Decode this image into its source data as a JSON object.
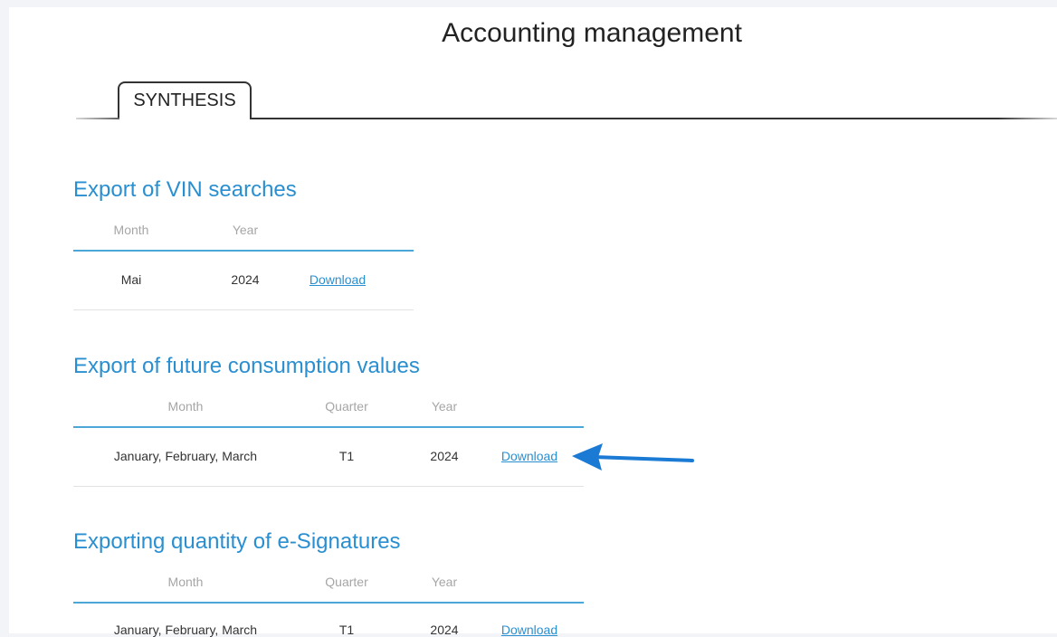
{
  "page": {
    "title": "Accounting management"
  },
  "tabs": [
    {
      "label": "SYNTHESIS",
      "active": true
    }
  ],
  "sections": [
    {
      "title": "Export of VIN searches",
      "columns": [
        "Month",
        "Year"
      ],
      "rows": [
        {
          "month": "Mai",
          "year": "2024",
          "action": "Download"
        }
      ]
    },
    {
      "title": "Export of future consumption values",
      "columns": [
        "Month",
        "Quarter",
        "Year"
      ],
      "rows": [
        {
          "month": "January, February, March",
          "quarter": "T1",
          "year": "2024",
          "action": "Download"
        }
      ]
    },
    {
      "title": "Exporting quantity of e-Signatures",
      "columns": [
        "Month",
        "Quarter",
        "Year"
      ],
      "rows": [
        {
          "month": "January, February, March",
          "quarter": "T1",
          "year": "2024",
          "action": "Download"
        }
      ]
    }
  ],
  "colors": {
    "accent": "#2a8fd0",
    "arrow": "#1a7ad4"
  },
  "annotation": {
    "icon": "arrow-left-icon"
  }
}
